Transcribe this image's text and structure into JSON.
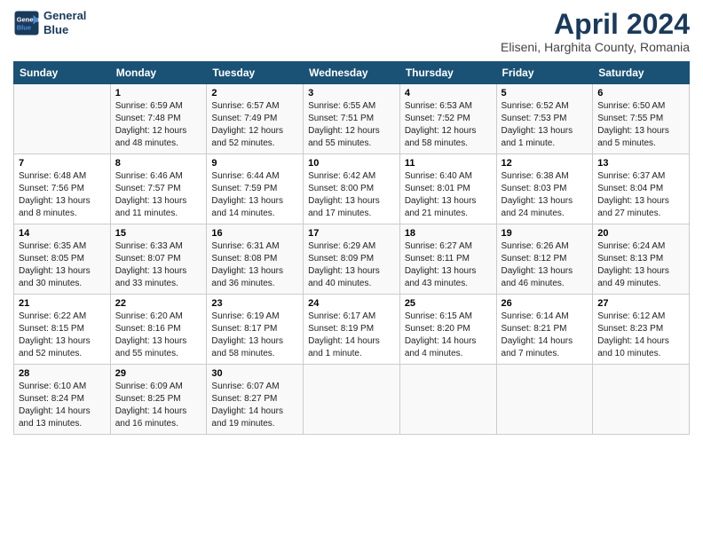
{
  "header": {
    "logo_line1": "General",
    "logo_line2": "Blue",
    "title": "April 2024",
    "subtitle": "Eliseni, Harghita County, Romania"
  },
  "days_of_week": [
    "Sunday",
    "Monday",
    "Tuesday",
    "Wednesday",
    "Thursday",
    "Friday",
    "Saturday"
  ],
  "weeks": [
    [
      {
        "day": "",
        "info": ""
      },
      {
        "day": "1",
        "info": "Sunrise: 6:59 AM\nSunset: 7:48 PM\nDaylight: 12 hours\nand 48 minutes."
      },
      {
        "day": "2",
        "info": "Sunrise: 6:57 AM\nSunset: 7:49 PM\nDaylight: 12 hours\nand 52 minutes."
      },
      {
        "day": "3",
        "info": "Sunrise: 6:55 AM\nSunset: 7:51 PM\nDaylight: 12 hours\nand 55 minutes."
      },
      {
        "day": "4",
        "info": "Sunrise: 6:53 AM\nSunset: 7:52 PM\nDaylight: 12 hours\nand 58 minutes."
      },
      {
        "day": "5",
        "info": "Sunrise: 6:52 AM\nSunset: 7:53 PM\nDaylight: 13 hours\nand 1 minute."
      },
      {
        "day": "6",
        "info": "Sunrise: 6:50 AM\nSunset: 7:55 PM\nDaylight: 13 hours\nand 5 minutes."
      }
    ],
    [
      {
        "day": "7",
        "info": "Sunrise: 6:48 AM\nSunset: 7:56 PM\nDaylight: 13 hours\nand 8 minutes."
      },
      {
        "day": "8",
        "info": "Sunrise: 6:46 AM\nSunset: 7:57 PM\nDaylight: 13 hours\nand 11 minutes."
      },
      {
        "day": "9",
        "info": "Sunrise: 6:44 AM\nSunset: 7:59 PM\nDaylight: 13 hours\nand 14 minutes."
      },
      {
        "day": "10",
        "info": "Sunrise: 6:42 AM\nSunset: 8:00 PM\nDaylight: 13 hours\nand 17 minutes."
      },
      {
        "day": "11",
        "info": "Sunrise: 6:40 AM\nSunset: 8:01 PM\nDaylight: 13 hours\nand 21 minutes."
      },
      {
        "day": "12",
        "info": "Sunrise: 6:38 AM\nSunset: 8:03 PM\nDaylight: 13 hours\nand 24 minutes."
      },
      {
        "day": "13",
        "info": "Sunrise: 6:37 AM\nSunset: 8:04 PM\nDaylight: 13 hours\nand 27 minutes."
      }
    ],
    [
      {
        "day": "14",
        "info": "Sunrise: 6:35 AM\nSunset: 8:05 PM\nDaylight: 13 hours\nand 30 minutes."
      },
      {
        "day": "15",
        "info": "Sunrise: 6:33 AM\nSunset: 8:07 PM\nDaylight: 13 hours\nand 33 minutes."
      },
      {
        "day": "16",
        "info": "Sunrise: 6:31 AM\nSunset: 8:08 PM\nDaylight: 13 hours\nand 36 minutes."
      },
      {
        "day": "17",
        "info": "Sunrise: 6:29 AM\nSunset: 8:09 PM\nDaylight: 13 hours\nand 40 minutes."
      },
      {
        "day": "18",
        "info": "Sunrise: 6:27 AM\nSunset: 8:11 PM\nDaylight: 13 hours\nand 43 minutes."
      },
      {
        "day": "19",
        "info": "Sunrise: 6:26 AM\nSunset: 8:12 PM\nDaylight: 13 hours\nand 46 minutes."
      },
      {
        "day": "20",
        "info": "Sunrise: 6:24 AM\nSunset: 8:13 PM\nDaylight: 13 hours\nand 49 minutes."
      }
    ],
    [
      {
        "day": "21",
        "info": "Sunrise: 6:22 AM\nSunset: 8:15 PM\nDaylight: 13 hours\nand 52 minutes."
      },
      {
        "day": "22",
        "info": "Sunrise: 6:20 AM\nSunset: 8:16 PM\nDaylight: 13 hours\nand 55 minutes."
      },
      {
        "day": "23",
        "info": "Sunrise: 6:19 AM\nSunset: 8:17 PM\nDaylight: 13 hours\nand 58 minutes."
      },
      {
        "day": "24",
        "info": "Sunrise: 6:17 AM\nSunset: 8:19 PM\nDaylight: 14 hours\nand 1 minute."
      },
      {
        "day": "25",
        "info": "Sunrise: 6:15 AM\nSunset: 8:20 PM\nDaylight: 14 hours\nand 4 minutes."
      },
      {
        "day": "26",
        "info": "Sunrise: 6:14 AM\nSunset: 8:21 PM\nDaylight: 14 hours\nand 7 minutes."
      },
      {
        "day": "27",
        "info": "Sunrise: 6:12 AM\nSunset: 8:23 PM\nDaylight: 14 hours\nand 10 minutes."
      }
    ],
    [
      {
        "day": "28",
        "info": "Sunrise: 6:10 AM\nSunset: 8:24 PM\nDaylight: 14 hours\nand 13 minutes."
      },
      {
        "day": "29",
        "info": "Sunrise: 6:09 AM\nSunset: 8:25 PM\nDaylight: 14 hours\nand 16 minutes."
      },
      {
        "day": "30",
        "info": "Sunrise: 6:07 AM\nSunset: 8:27 PM\nDaylight: 14 hours\nand 19 minutes."
      },
      {
        "day": "",
        "info": ""
      },
      {
        "day": "",
        "info": ""
      },
      {
        "day": "",
        "info": ""
      },
      {
        "day": "",
        "info": ""
      }
    ]
  ]
}
